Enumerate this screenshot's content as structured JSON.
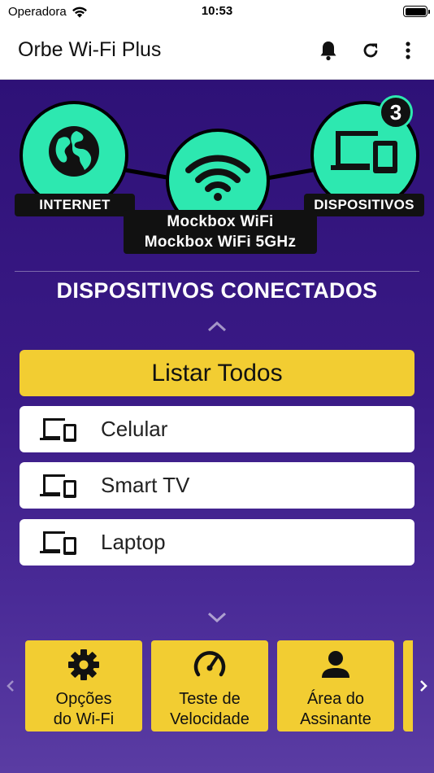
{
  "status_bar": {
    "carrier": "Operadora",
    "time": "10:53"
  },
  "app_bar": {
    "title": "Orbe Wi-Fi Plus",
    "icons": [
      "bell-icon",
      "refresh-icon",
      "more-vertical-icon"
    ]
  },
  "topology": {
    "internet_label": "INTERNET",
    "router_ssid_1": "Mockbox WiFi",
    "router_ssid_2": "Mockbox WiFi 5GHz",
    "devices_label": "DISPOSITIVOS",
    "devices_count": "3",
    "node_color": "#2de8b0"
  },
  "devices_section": {
    "title": "DISPOSITIVOS CONECTADOS",
    "list_all_label": "Listar Todos",
    "devices": [
      {
        "name": "Celular",
        "icon": "devices-icon"
      },
      {
        "name": "Smart TV",
        "icon": "devices-icon"
      },
      {
        "name": "Laptop",
        "icon": "devices-icon"
      }
    ]
  },
  "shortcuts": [
    {
      "line1": "Opções",
      "line2": "do Wi-Fi",
      "icon": "gear-icon"
    },
    {
      "line1": "Teste de",
      "line2": "Velocidade",
      "icon": "speedometer-icon"
    },
    {
      "line1": "Área do",
      "line2": "Assinante",
      "icon": "user-icon"
    }
  ],
  "colors": {
    "accent_yellow": "#f2cd32",
    "background_purple": "#3a1a86",
    "node_green": "#2de8b0"
  }
}
